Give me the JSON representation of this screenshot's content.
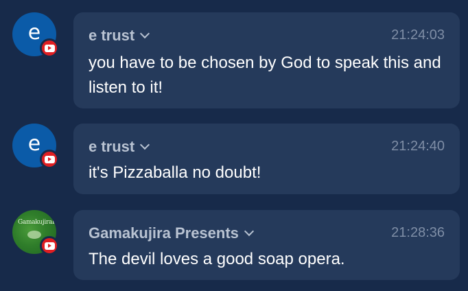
{
  "messages": [
    {
      "author": "e trust",
      "time": "21:24:03",
      "text": "you have to be chosen by God to speak this and listen to it!",
      "avatar_letter": "e",
      "avatar_type": "letter",
      "platform_icon": "youtube-icon"
    },
    {
      "author": "e trust",
      "time": "21:24:40",
      "text": "it's Pizzaballa no doubt!",
      "avatar_letter": "e",
      "avatar_type": "letter",
      "platform_icon": "youtube-icon"
    },
    {
      "author": "Gamakujira Presents",
      "time": "21:28:36",
      "text": "The devil loves a good soap opera.",
      "avatar_type": "image",
      "avatar_caption": "GamakujiraPresents",
      "platform_icon": "youtube-icon"
    }
  ],
  "colors": {
    "background": "#172a4a",
    "bubble": "#253a5b",
    "author": "#b9c3d2",
    "timestamp": "#7f8ea6",
    "message_text": "#ffffff",
    "letter_avatar": "#0b5ba8",
    "youtube_red": "#e01e22"
  }
}
